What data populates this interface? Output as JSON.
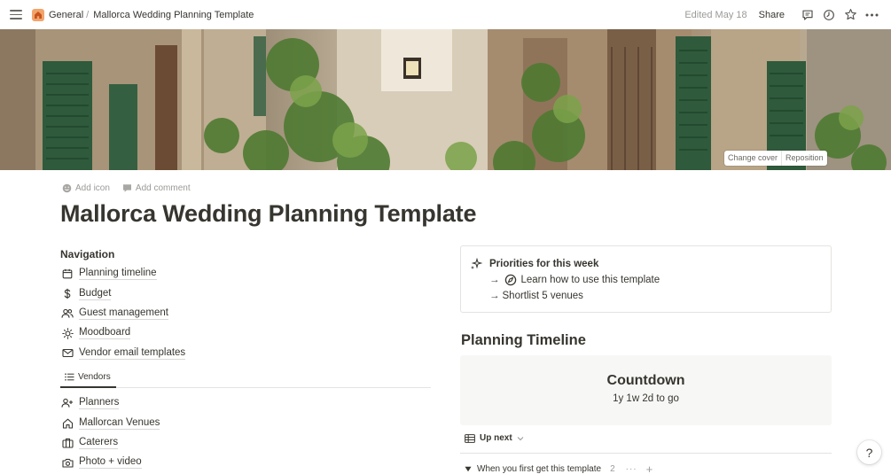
{
  "topbar": {
    "breadcrumbs": [
      "General",
      "Mallorca Wedding Planning Template"
    ],
    "edited": "Edited May 18",
    "share": "Share",
    "workspace_icon": "house-icon",
    "icons": [
      "menu-icon",
      "comment-icon",
      "history-icon",
      "star-icon",
      "more-icon"
    ]
  },
  "cover": {
    "change_cover": "Change cover",
    "reposition": "Reposition"
  },
  "page": {
    "add_icon": "Add icon",
    "add_comment": "Add comment",
    "title": "Mallorca Wedding Planning Template"
  },
  "navigation": {
    "heading": "Navigation",
    "items": [
      {
        "label": "Planning timeline",
        "icon": "calendar-icon"
      },
      {
        "label": "Budget",
        "icon": "dollar-icon"
      },
      {
        "label": "Guest management",
        "icon": "people-icon"
      },
      {
        "label": "Moodboard",
        "icon": "sun-icon"
      },
      {
        "label": "Vendor email templates",
        "icon": "mail-icon"
      }
    ]
  },
  "vendors": {
    "tab_label": "Vendors",
    "items": [
      {
        "label": "Planners",
        "icon": "person-add-icon"
      },
      {
        "label": "Mallorcan Venues",
        "icon": "home-icon"
      },
      {
        "label": "Caterers",
        "icon": "briefcase-icon"
      },
      {
        "label": "Photo + video",
        "icon": "camera-icon"
      }
    ]
  },
  "priorities": {
    "title": "Priorities for this week",
    "lines": [
      "Learn how to use this template",
      "Shortlist 5 venues"
    ],
    "arrow": "→"
  },
  "timeline": {
    "title": "Planning Timeline",
    "countdown_title": "Countdown",
    "countdown_value": "1y 1w 2d to go",
    "view_label": "Up next",
    "group_label": "When you first get this template",
    "group_count": "2"
  },
  "help": {
    "label": "?"
  },
  "colors": {
    "text": "#37352f",
    "muted": "#9b9a97",
    "border": "#e4e3e0"
  }
}
